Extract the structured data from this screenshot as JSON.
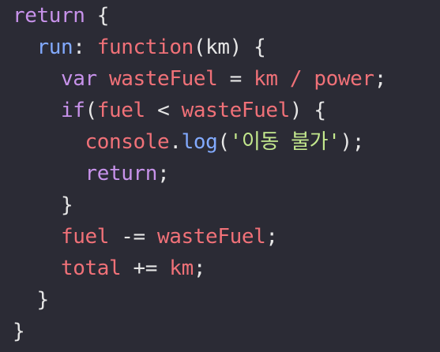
{
  "code": {
    "lines": [
      [
        {
          "t": "return",
          "c": "kw"
        },
        {
          "t": " {",
          "c": "punct"
        }
      ],
      [
        {
          "t": "  ",
          "c": "plain"
        },
        {
          "t": "run",
          "c": "prop"
        },
        {
          "t": ": ",
          "c": "punct"
        },
        {
          "t": "function",
          "c": "fn"
        },
        {
          "t": "(km) {",
          "c": "punct"
        }
      ],
      [
        {
          "t": "    ",
          "c": "plain"
        },
        {
          "t": "var",
          "c": "kw"
        },
        {
          "t": " ",
          "c": "plain"
        },
        {
          "t": "wasteFuel",
          "c": "var"
        },
        {
          "t": " = ",
          "c": "op"
        },
        {
          "t": "km",
          "c": "var"
        },
        {
          "t": " ",
          "c": "plain"
        },
        {
          "t": "/",
          "c": "var"
        },
        {
          "t": " ",
          "c": "plain"
        },
        {
          "t": "power",
          "c": "var"
        },
        {
          "t": ";",
          "c": "punct"
        }
      ],
      [
        {
          "t": "    ",
          "c": "plain"
        },
        {
          "t": "if",
          "c": "kw"
        },
        {
          "t": "(",
          "c": "punct"
        },
        {
          "t": "fuel",
          "c": "var"
        },
        {
          "t": " < ",
          "c": "op"
        },
        {
          "t": "wasteFuel",
          "c": "var"
        },
        {
          "t": ") {",
          "c": "punct"
        }
      ],
      [
        {
          "t": "      ",
          "c": "plain"
        },
        {
          "t": "console",
          "c": "var"
        },
        {
          "t": ".",
          "c": "punct"
        },
        {
          "t": "log",
          "c": "method"
        },
        {
          "t": "(",
          "c": "punct"
        },
        {
          "t": "'이동 불가'",
          "c": "str"
        },
        {
          "t": ");",
          "c": "punct"
        }
      ],
      [
        {
          "t": "      ",
          "c": "plain"
        },
        {
          "t": "return",
          "c": "kw"
        },
        {
          "t": ";",
          "c": "punct"
        }
      ],
      [
        {
          "t": "    ",
          "c": "plain"
        },
        {
          "t": "}",
          "c": "punct"
        }
      ],
      [
        {
          "t": "    ",
          "c": "plain"
        },
        {
          "t": "fuel",
          "c": "var"
        },
        {
          "t": " -= ",
          "c": "op"
        },
        {
          "t": "wasteFuel",
          "c": "var"
        },
        {
          "t": ";",
          "c": "punct"
        }
      ],
      [
        {
          "t": "    ",
          "c": "plain"
        },
        {
          "t": "total",
          "c": "var"
        },
        {
          "t": " += ",
          "c": "op"
        },
        {
          "t": "km",
          "c": "var"
        },
        {
          "t": ";",
          "c": "punct"
        }
      ],
      [
        {
          "t": "  ",
          "c": "plain"
        },
        {
          "t": "}",
          "c": "punct"
        }
      ],
      [
        {
          "t": "}",
          "c": "punct"
        }
      ]
    ]
  },
  "colors": {
    "background": "#2b2b35",
    "keyword": "#c792ea",
    "variable": "#f07178",
    "property": "#82aaff",
    "string": "#c3e88d",
    "text": "#e6e6e6"
  }
}
